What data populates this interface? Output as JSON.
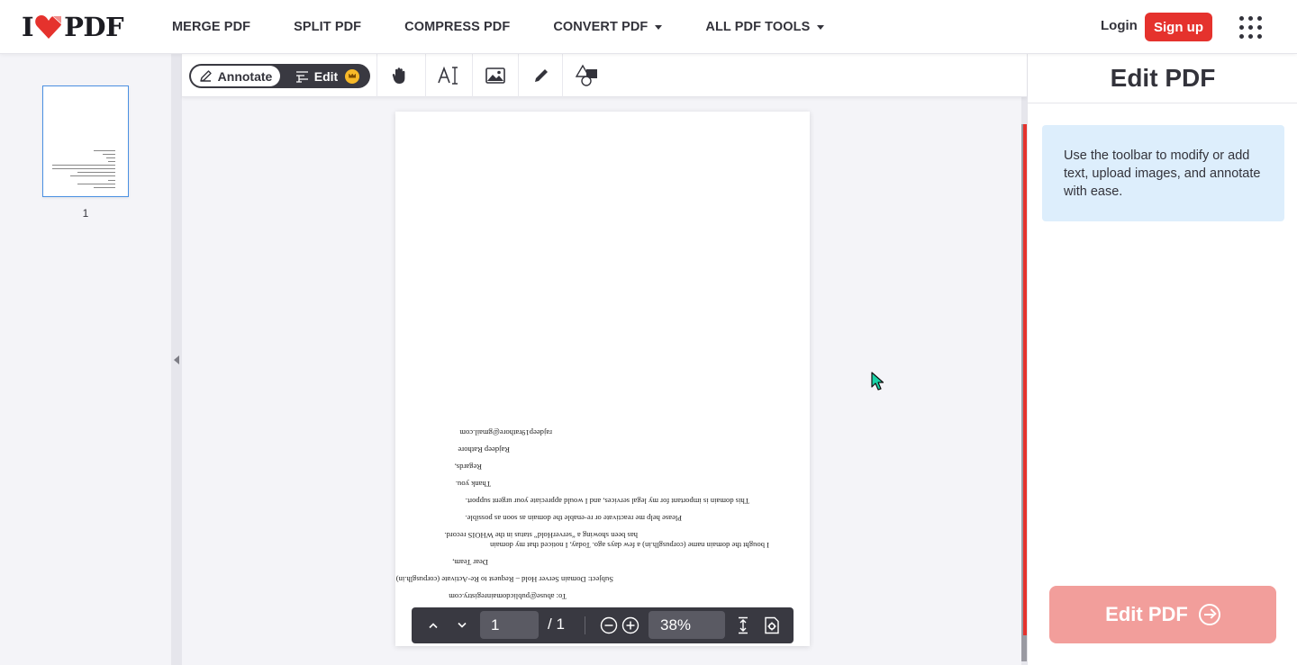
{
  "header": {
    "logo_left": "I",
    "logo_right": "PDF",
    "nav": [
      {
        "label": "MERGE PDF",
        "dropdown": false
      },
      {
        "label": "SPLIT PDF",
        "dropdown": false
      },
      {
        "label": "COMPRESS PDF",
        "dropdown": false
      },
      {
        "label": "CONVERT PDF",
        "dropdown": true
      },
      {
        "label": "ALL PDF TOOLS",
        "dropdown": true
      }
    ],
    "login": "Login",
    "signup": "Sign up"
  },
  "sidebar": {
    "thumbnails": [
      {
        "page_label": "1"
      }
    ]
  },
  "toolbar": {
    "annotate_label": "Annotate",
    "edit_label": "Edit",
    "tools": [
      "hand-icon",
      "text-icon",
      "image-icon",
      "pencil-icon",
      "shapes-icon"
    ]
  },
  "document": {
    "orientation": "upside-down",
    "lines": [
      "To: abuse@publicdomainregistry.com",
      "Subject: Domain Server Hold – Request to Re-Activate (corpusglh.in)",
      "Dear Team,",
      "I bought the domain name (corpusglh.in) a few days ago. Today, I noticed that my domain",
      "has been showing a “serverHold” status in the WHOIS record.",
      "Please help me reactivate or re-enable the domain as soon as possible.",
      "This domain is important for my legal services, and I would appreciate your urgent support.",
      "Thank you.",
      "Regards,",
      "Rajdeep Rathore",
      "rajdeep19rathore@gmail.com"
    ]
  },
  "pager": {
    "current_page": "1",
    "total": "/ 1",
    "zoom": "38%"
  },
  "panel": {
    "title": "Edit PDF",
    "info": "Use the toolbar to modify or add text, upload images, and annotate with ease.",
    "cta": "Edit PDF"
  },
  "colors": {
    "brand_red": "#e5322d",
    "cta_disabled": "#f29e9b",
    "info_bg": "#ddeefc",
    "dark_bar": "#393941"
  }
}
